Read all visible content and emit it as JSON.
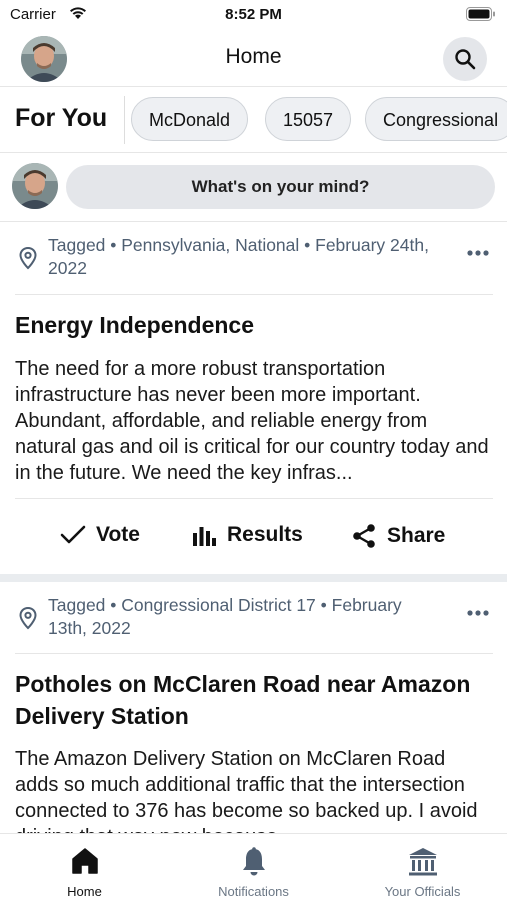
{
  "status_bar": {
    "carrier": "Carrier",
    "time": "8:52 PM"
  },
  "header": {
    "title": "Home"
  },
  "topics": {
    "heading": "For You",
    "chips": [
      "McDonald",
      "15057",
      "Congressional"
    ]
  },
  "composer": {
    "placeholder": "What's on your mind?"
  },
  "posts": [
    {
      "meta": "Tagged • Pennsylvania, National • February 24th, 2022",
      "title": "Energy Independence",
      "body": "The need for a more robust transportation infrastructure has never been more important. Abundant, affordable, and reliable energy from natural gas and oil is critical for our country today and in the future. We need the key infras...",
      "actions": {
        "vote": "Vote",
        "results": "Results",
        "share": "Share"
      }
    },
    {
      "meta": "Tagged • Congressional District 17 • February 13th, 2022",
      "title": "Potholes on McClaren Road near Amazon Delivery Station",
      "body": "The Amazon Delivery Station on McClaren Road adds so much additional traffic that the intersection connected to 376 has become so backed up. I avoid driving that way now because"
    }
  ],
  "tabs": [
    {
      "label": "Home",
      "icon": "home-icon",
      "active": true
    },
    {
      "label": "Notifications",
      "icon": "bell-icon",
      "active": false
    },
    {
      "label": "Your Officials",
      "icon": "capitol-icon",
      "active": false
    }
  ],
  "colors": {
    "accent": "#111111",
    "meta": "#4f5f72",
    "chip_bg": "#eef0f3",
    "pill_bg": "#e4e6ea",
    "inactive_tab": "#6b7785"
  }
}
